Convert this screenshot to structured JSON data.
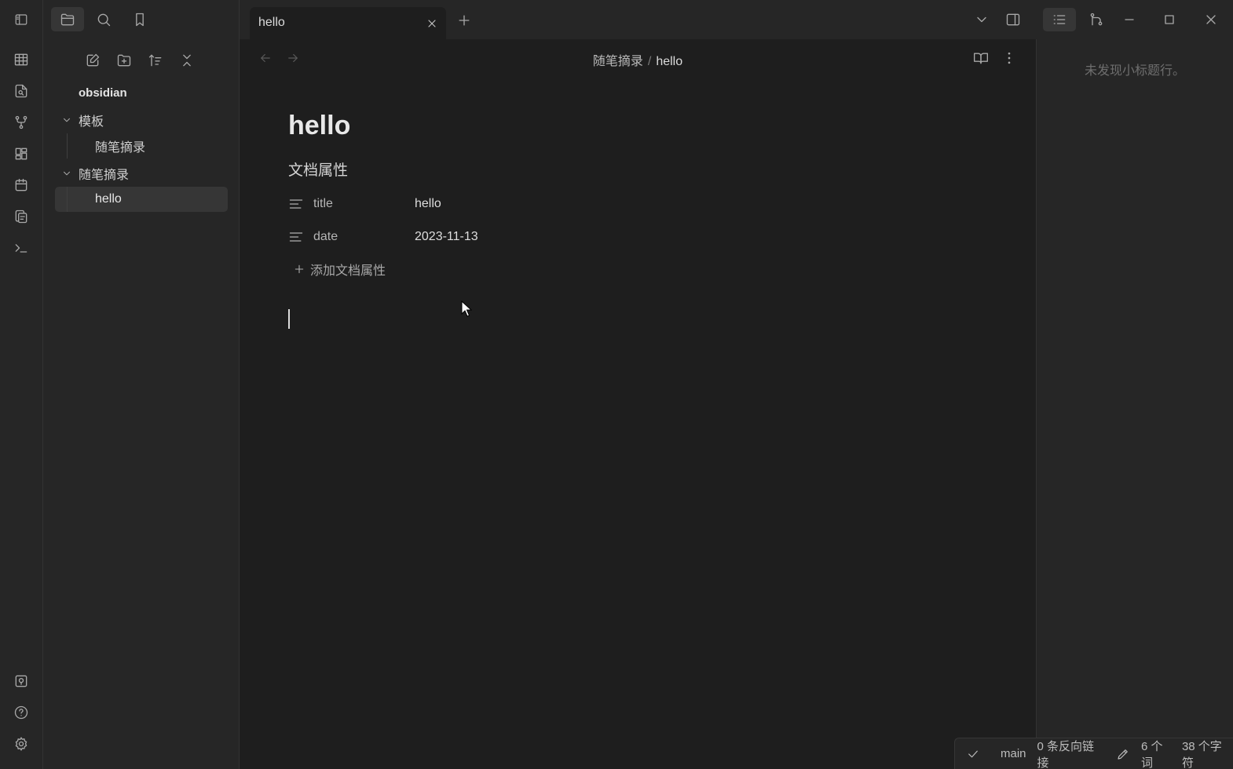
{
  "tabs": [
    {
      "title": "hello"
    }
  ],
  "sidebar": {
    "vault_name": "obsidian",
    "folders": [
      {
        "name": "模板",
        "children": [
          "随笔摘录"
        ]
      },
      {
        "name": "随笔摘录",
        "children": [
          "hello"
        ]
      }
    ]
  },
  "breadcrumb": {
    "folder": "随笔摘录",
    "separator": "/",
    "current": "hello"
  },
  "note": {
    "title": "hello",
    "properties_heading": "文档属性",
    "properties": [
      {
        "key": "title",
        "value": "hello"
      },
      {
        "key": "date",
        "value": "2023-11-13"
      }
    ],
    "add_property_label": "添加文档属性"
  },
  "outline": {
    "empty_text": "未发现小标题行。"
  },
  "status": {
    "branch": "main",
    "backlinks": "0 条反向链接",
    "words": "6 个词",
    "chars": "38 个字符"
  }
}
